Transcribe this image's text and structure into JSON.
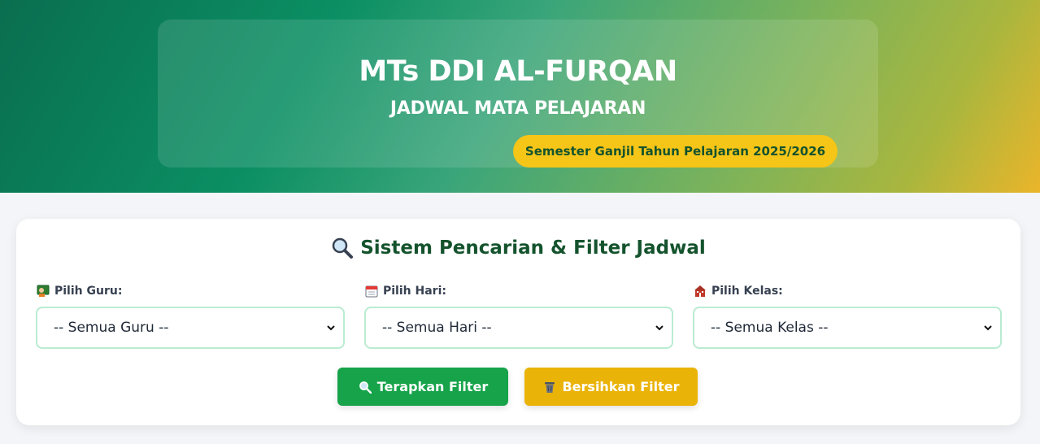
{
  "header": {
    "school_name": "MTs DDI AL-FURQAN",
    "subtitle": "JADWAL MATA PELAJARAN",
    "semester": "Semester Ganjil Tahun Pelajaran 2025/2026"
  },
  "filter": {
    "title": "Sistem Pencarian & Filter Jadwal",
    "title_icon": "magnifier-icon",
    "fields": [
      {
        "label": "Pilih Guru:",
        "icon": "teacher-icon",
        "selected": "-- Semua Guru --"
      },
      {
        "label": "Pilih Hari:",
        "icon": "calendar-icon",
        "selected": "-- Semua Hari --"
      },
      {
        "label": "Pilih Kelas:",
        "icon": "school-icon",
        "selected": "-- Semua Kelas --"
      }
    ],
    "apply_label": "Terapkan Filter",
    "clear_label": "Bersihkan Filter"
  },
  "colors": {
    "primary_green": "#16a34a",
    "accent_yellow": "#eab308",
    "title_green": "#14532d"
  }
}
